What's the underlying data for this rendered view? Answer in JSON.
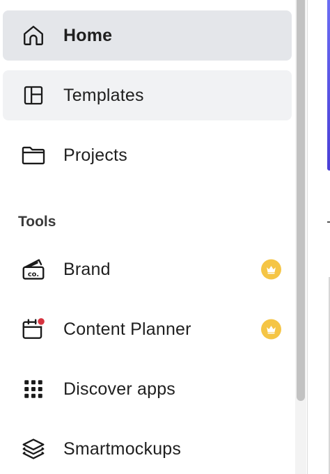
{
  "nav": {
    "home": "Home",
    "templates": "Templates",
    "projects": "Projects"
  },
  "tools": {
    "heading": "Tools",
    "brand": "Brand",
    "content_planner": "Content Planner",
    "discover_apps": "Discover apps",
    "smartmockups": "Smartmockups"
  },
  "icons": {
    "home": "home-icon",
    "templates": "templates-layout-icon",
    "projects": "folder-icon",
    "brand": "brand-kit-icon",
    "content_planner": "calendar-icon",
    "discover_apps": "apps-grid-icon",
    "smartmockups": "layers-icon",
    "premium": "crown-icon"
  },
  "colors": {
    "active_bg": "#e4e6ea",
    "hover_bg": "#f1f2f4",
    "crown_badge": "#f5c545",
    "notification_dot": "#d6333f"
  }
}
